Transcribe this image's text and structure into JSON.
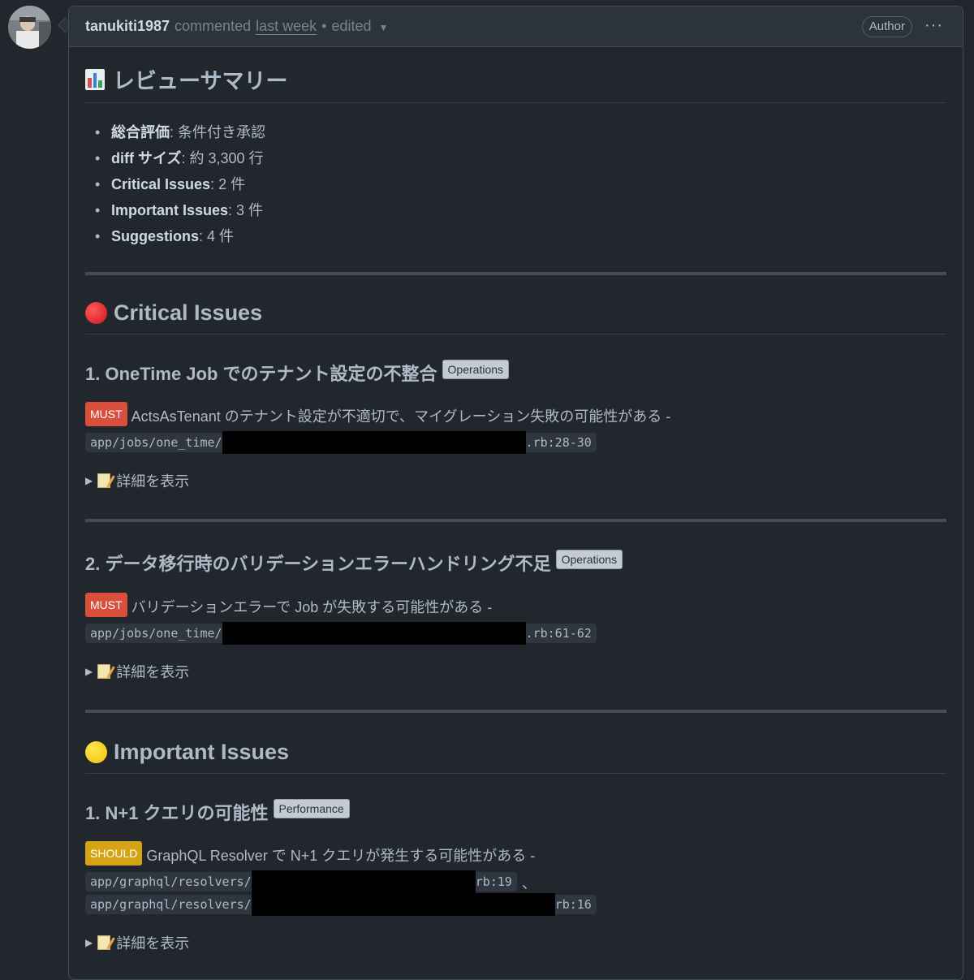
{
  "header": {
    "author": "tanukiti1987",
    "action": "commented",
    "time": "last week",
    "separator": "•",
    "edited": "edited",
    "author_badge": "Author",
    "more_icon": "kebab-horizontal-icon"
  },
  "summary": {
    "title": "レビューサマリー",
    "items": [
      {
        "key": "総合評価",
        "value": ": 条件付き承認"
      },
      {
        "key": "diff サイズ",
        "value": ": 約 3,300 行"
      },
      {
        "key": "Critical Issues",
        "value": ": 2 件"
      },
      {
        "key": "Important Issues",
        "value": ": 3 件"
      },
      {
        "key": "Suggestions",
        "value": ": 4 件"
      }
    ]
  },
  "critical": {
    "title": "Critical Issues",
    "issues": [
      {
        "heading": "1. OneTime Job でのテナント設定の不整合",
        "label": "Operations",
        "badge": "MUST",
        "text": "ActsAsTenant のテナント設定が不適切で、マイグレーション失敗の可能性がある -",
        "path_prefix": "app/jobs/one_time/",
        "path_suffix": ".rb:28-30",
        "details": "詳細を表示"
      },
      {
        "heading": "2. データ移行時のバリデーションエラーハンドリング不足",
        "label": "Operations",
        "badge": "MUST",
        "text": "バリデーションエラーで Job が失敗する可能性がある -",
        "path_prefix": "app/jobs/one_time/",
        "path_suffix": ".rb:61-62",
        "details": "詳細を表示"
      }
    ]
  },
  "important": {
    "title": "Important Issues",
    "issues": [
      {
        "heading": "1. N+1 クエリの可能性",
        "label": "Performance",
        "badge": "SHOULD",
        "text": "GraphQL Resolver で N+1 クエリが発生する可能性がある -",
        "path1_prefix": "app/graphql/resolvers/",
        "path1_suffix": "rb:19",
        "path_separator": "、",
        "path2_prefix": "app/graphql/resolvers/",
        "path2_suffix": "rb:16",
        "details": "詳細を表示"
      }
    ]
  },
  "colors": {
    "background": "#22272e",
    "header_bg": "#2d333b",
    "must": "#da4f3b",
    "should": "#d4a414"
  }
}
